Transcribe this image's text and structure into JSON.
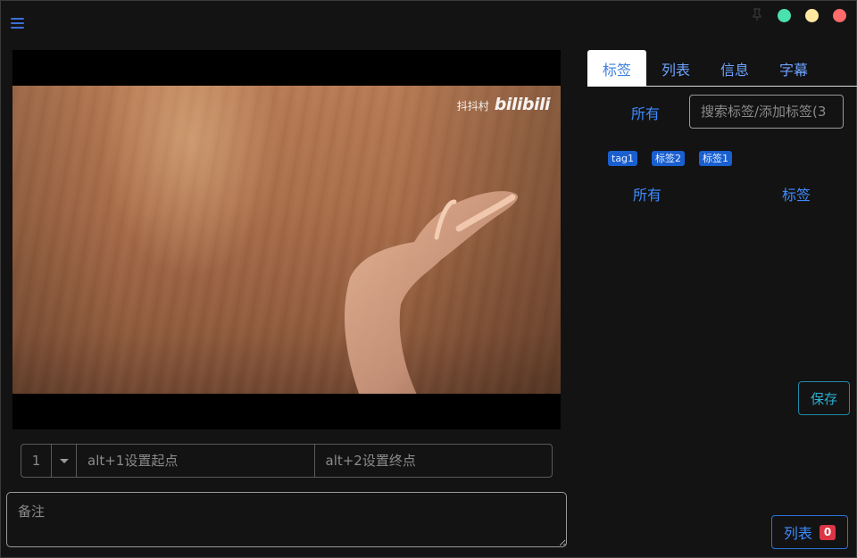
{
  "window": {
    "menu_icon": "hamburger-icon",
    "pin_icon": "pin-icon",
    "controls": {
      "green": "#4be0b0",
      "yellow": "#ffe7a0",
      "red": "#ff6b6b"
    }
  },
  "video": {
    "watermark_text": "抖抖村",
    "watermark_logo": "bilibili"
  },
  "segment": {
    "index": "1",
    "start_placeholder": "alt+1设置起点",
    "end_placeholder": "alt+2设置终点"
  },
  "notes": {
    "placeholder": "备注"
  },
  "tabs": [
    {
      "label": "标签",
      "active": true
    },
    {
      "label": "列表",
      "active": false
    },
    {
      "label": "信息",
      "active": false
    },
    {
      "label": "字幕",
      "active": false
    }
  ],
  "tag_panel": {
    "filter_all": "所有",
    "search_placeholder": "搜索标签/添加标签(3",
    "tags": [
      "tag1",
      "标签2",
      "标签1"
    ],
    "column_all": "所有",
    "column_tag": "标签"
  },
  "buttons": {
    "save": "保存",
    "list": "列表",
    "list_count": "0"
  },
  "colors": {
    "accent": "#3d8bff",
    "tag_bg": "#1a5fd0",
    "save_border": "#1f8aa6",
    "badge": "#dc3545"
  }
}
